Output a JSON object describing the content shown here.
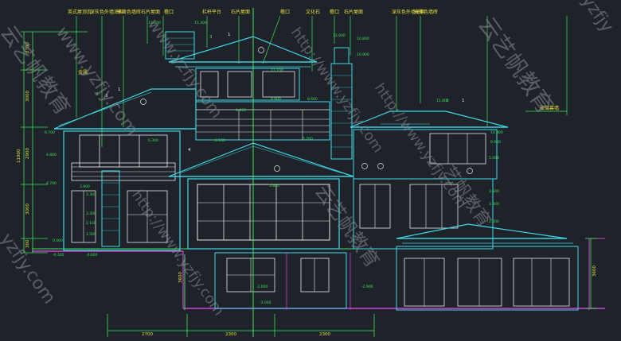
{
  "drawing": {
    "callouts_top": [
      "英式屋顶瓦",
      "深灰色外墙涂料",
      "米黄色墙砖",
      "石片屋面",
      "檐口",
      "栏杆平台",
      "石片屋面",
      "檐口",
      "文化石",
      "檐口",
      "石片屋面",
      "深灰色外墙涂料",
      "米黄色墙砖"
    ],
    "callouts_side": [
      "金属"
    ],
    "callout_right": "玻璃幕墙",
    "dims_left": [
      "2700",
      "3000",
      "2900",
      "3000",
      "11900",
      "3300",
      "300"
    ],
    "dims_right": [
      "3600"
    ],
    "dims_center": [
      "3600"
    ],
    "dims_bottom": [
      "2700",
      "2300",
      "2300"
    ],
    "elevations": [
      "12.600",
      "12.100",
      "10.800",
      "9.900",
      "9.900",
      "8.600",
      "6.700",
      "6.300",
      "6.100",
      "5.700",
      "5.000",
      "4.800",
      "4.700",
      "3.900",
      "3.800",
      "3.500",
      "3.300",
      "3.300",
      "3.000",
      "2.100",
      "2.000",
      "1.500",
      "0.000",
      "-0.300",
      "-0.600",
      "-2.600",
      "-2.900",
      "-3.000",
      "12.600",
      "10.900",
      "11.300",
      "10.800",
      "9.900",
      "11.800"
    ],
    "section_marks": [
      "1",
      "3",
      "4",
      "1",
      "1"
    ],
    "grid_labels": [
      "3",
      "3",
      "1"
    ]
  },
  "watermarks": [
    "www.yzfjy.com",
    "www.yzfjy.com",
    "http://www.yzfjy.com",
    "http://www.yzfjy.com",
    "云艺帆教育",
    "云艺帆教育",
    "yzfjy.com",
    "云艺帆教育",
    "http://www.yzfjy.com",
    "yzfjy",
    "艺帆教育"
  ],
  "colors": {
    "background": "#1e2229",
    "cyan": "#3fd8e6",
    "white": "#e8e8e8",
    "green": "#3ee05a",
    "magenta": "#d040d8",
    "yellow": "#e8e040",
    "red": "#e04040",
    "blue": "#4060ff",
    "gray": "#8a8f98"
  }
}
